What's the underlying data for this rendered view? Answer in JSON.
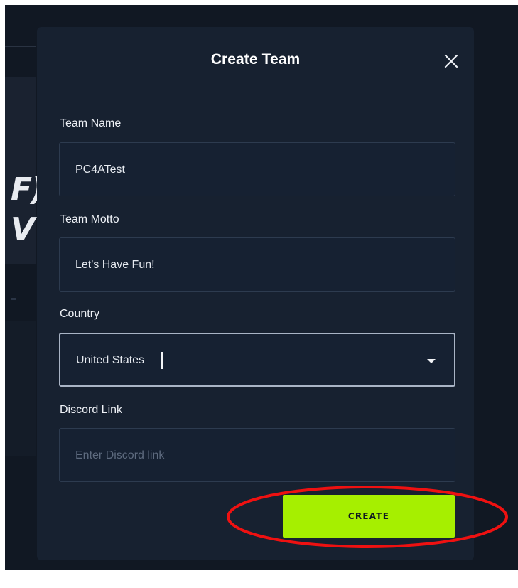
{
  "modal": {
    "title": "Create Team"
  },
  "form": {
    "team_name": {
      "label": "Team Name",
      "value": "PC4ATest"
    },
    "team_motto": {
      "label": "Team Motto",
      "value": "Let's Have Fun!"
    },
    "country": {
      "label": "Country",
      "value": "United States"
    },
    "discord_link": {
      "label": "Discord Link",
      "placeholder": "Enter Discord link",
      "value": ""
    }
  },
  "actions": {
    "create_label": "CREATE"
  },
  "background": {
    "graffiti_text": "F)\nV"
  },
  "icons": {
    "close": "close-icon",
    "dropdown": "chevron-down-icon"
  },
  "colors": {
    "app_background": "#111823",
    "modal_background": "#172130",
    "primary_button": "#a6ef00",
    "annotation": "#ef1111"
  }
}
